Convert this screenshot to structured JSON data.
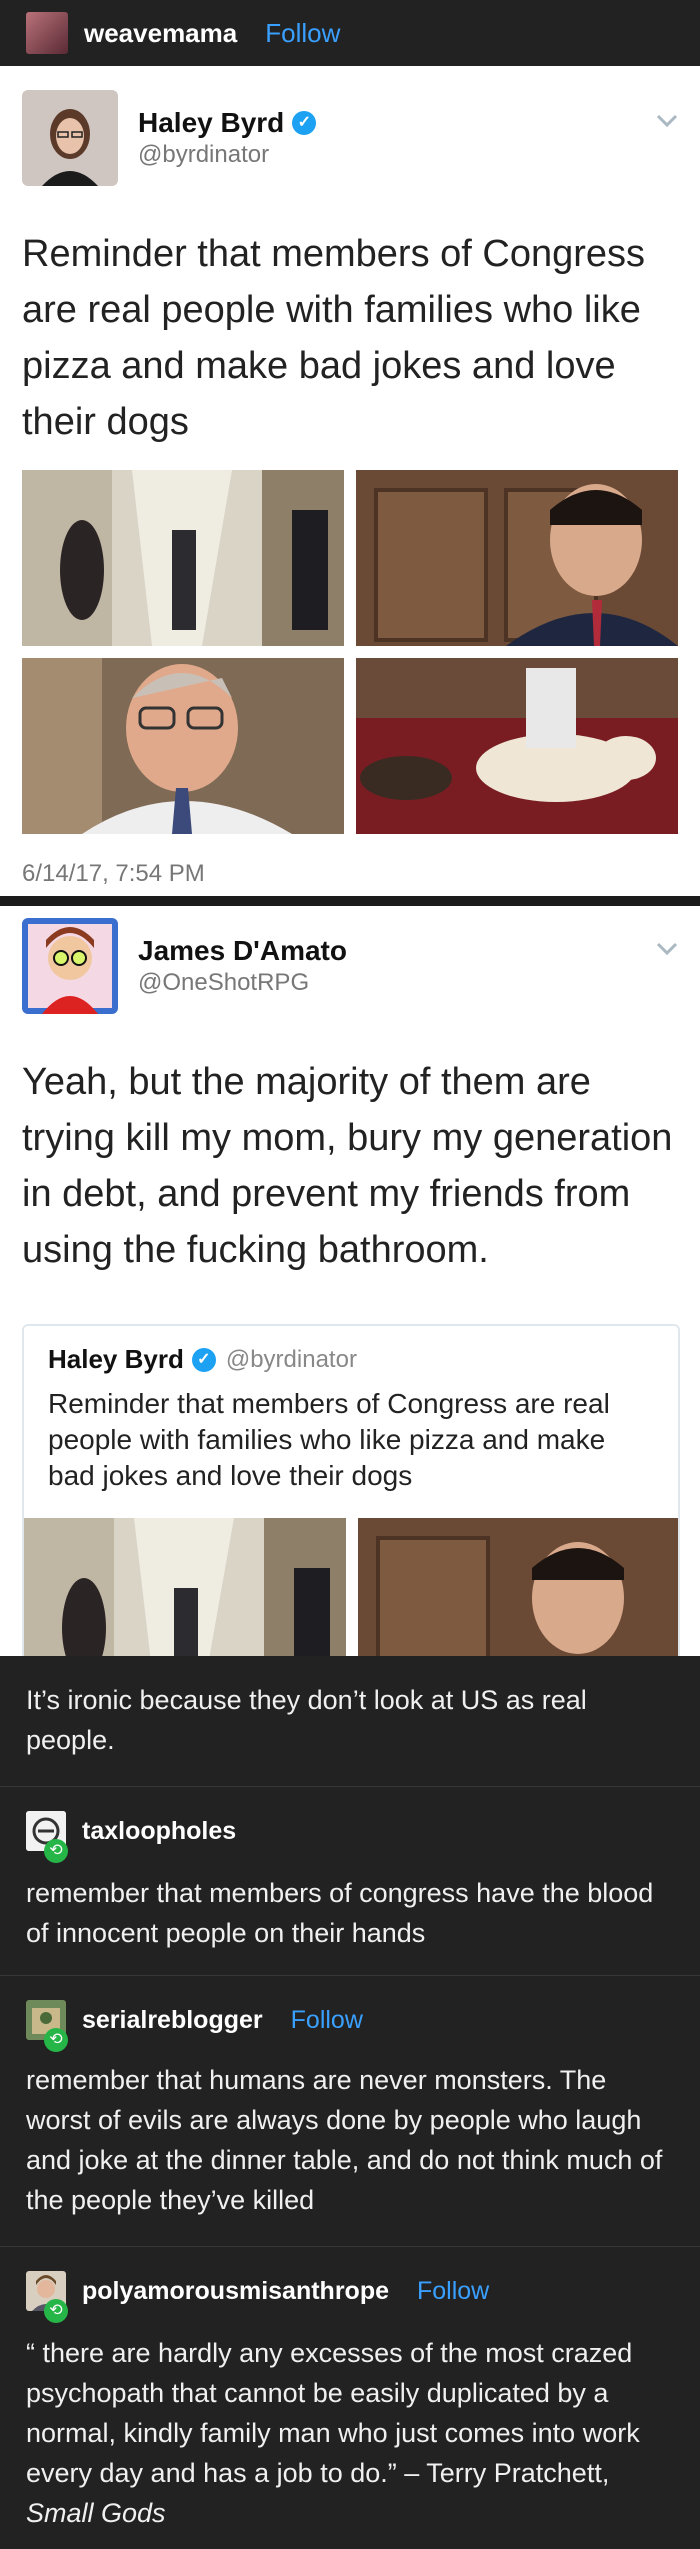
{
  "header": {
    "username": "weavemama",
    "follow": "Follow"
  },
  "tweet1": {
    "name": "Haley Byrd",
    "handle": "@byrdinator",
    "text": "Reminder that members of Congress are real people with families who like pizza and make bad jokes and love their dogs",
    "date": "6/14/17, 7:54 PM"
  },
  "tweet2": {
    "name": "James D'Amato",
    "handle": "@OneShotRPG",
    "text": "Yeah, but the majority of them are trying kill my mom, bury my generation in debt, and prevent my friends from using the fucking bathroom.",
    "quote": {
      "name": "Haley Byrd",
      "handle": "@byrdinator",
      "text": "Reminder that members of Congress are real people with families who like pizza and make bad jokes and love their dogs"
    }
  },
  "posts": [
    {
      "text": "It’s ironic because they don’t look at US as real people."
    },
    {
      "username": "taxloopholes",
      "text": "remember that members of congress have the blood of innocent people on their hands"
    },
    {
      "username": "serialreblogger",
      "follow": "Follow",
      "text": "remember that humans are never monsters. The worst of evils are always done by people who laugh and joke at the dinner table, and do not think much of the people they’ve killed"
    },
    {
      "username": "polyamorousmisanthrope",
      "follow": "Follow",
      "text_open": "“  there are hardly any excesses of the most crazed psychopath that cannot be easily duplicated by a normal, kindly family man who just comes into work every day and has a job to do.” – Terry Pratchett, ",
      "text_title": "Small Gods"
    }
  ],
  "icons": {
    "verified": "verified-badge-icon",
    "reblog": "reblog-icon",
    "chevron": "chevron-down-icon"
  },
  "colors": {
    "follow": "#3aa0ff",
    "verified": "#1da1f2",
    "reblog": "#26b547",
    "background": "#222222"
  }
}
